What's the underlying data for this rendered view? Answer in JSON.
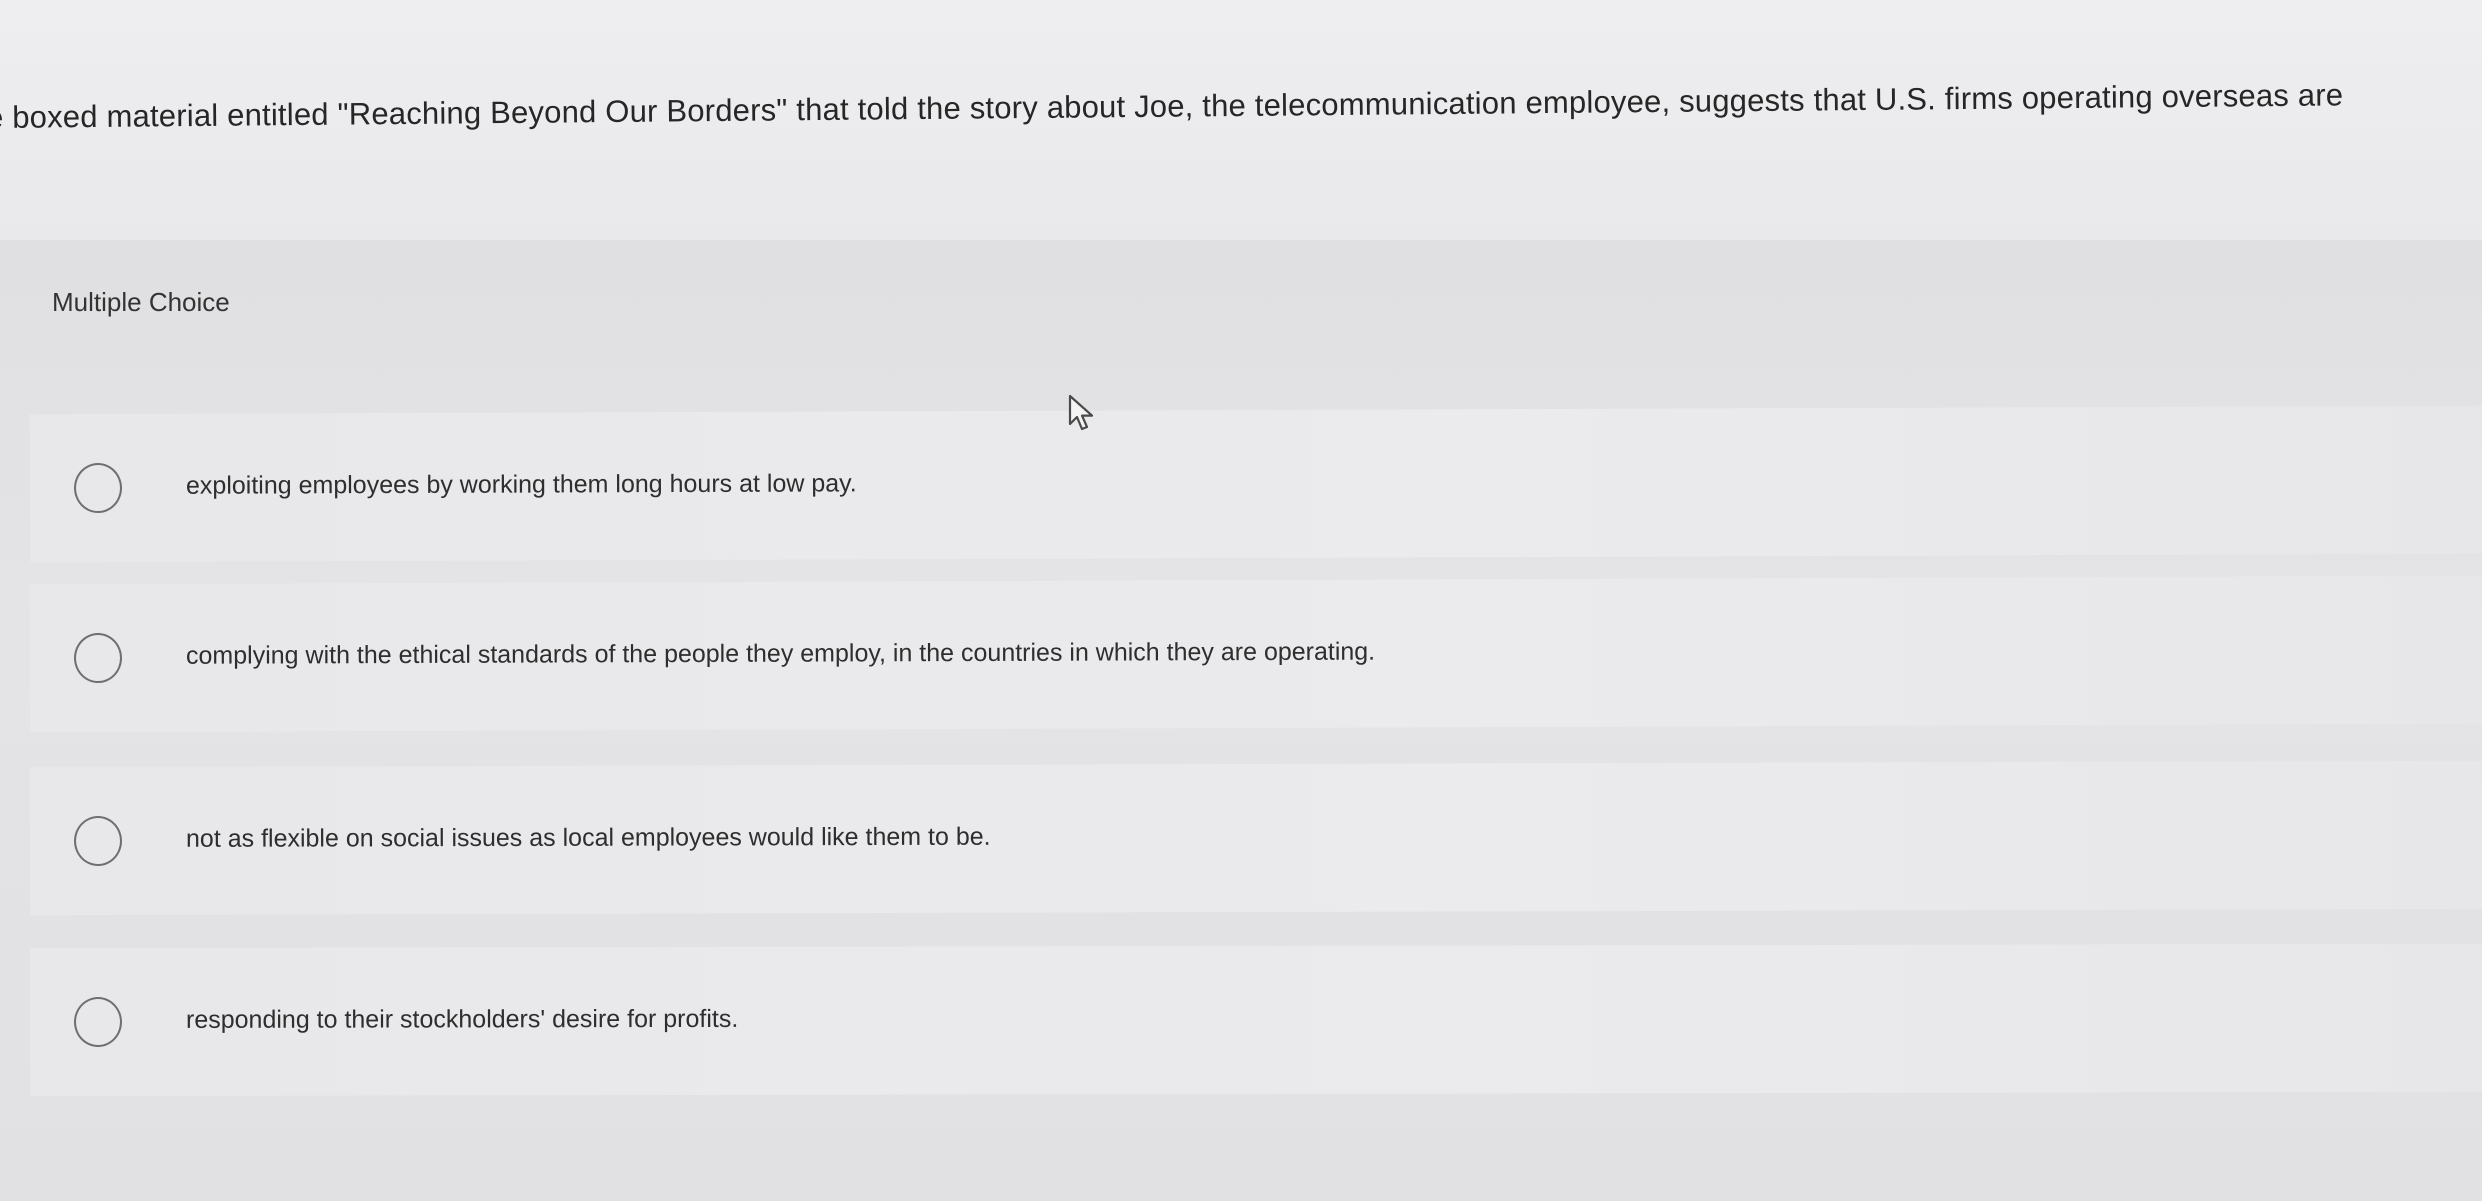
{
  "question": {
    "text": "e boxed material entitled \"Reaching Beyond Our Borders\" that told the story about Joe, the telecommunication employee, suggests that U.S. firms operating overseas are"
  },
  "question_type": "Multiple Choice",
  "choices": [
    {
      "label": "exploiting employees by working them long hours at low pay."
    },
    {
      "label": "complying with the ethical standards of the people they employ, in the countries in which they are operating."
    },
    {
      "label": "not as flexible on social issues as local employees would like them to be."
    },
    {
      "label": "responding to their stockholders' desire for profits."
    }
  ],
  "icons": {
    "cursor": "mouse-pointer-icon",
    "radio": "radio-circle-icon"
  },
  "colors": {
    "background": "#e6e6e8",
    "text": "#2b2b2b",
    "radio_border": "#6f6f72"
  }
}
